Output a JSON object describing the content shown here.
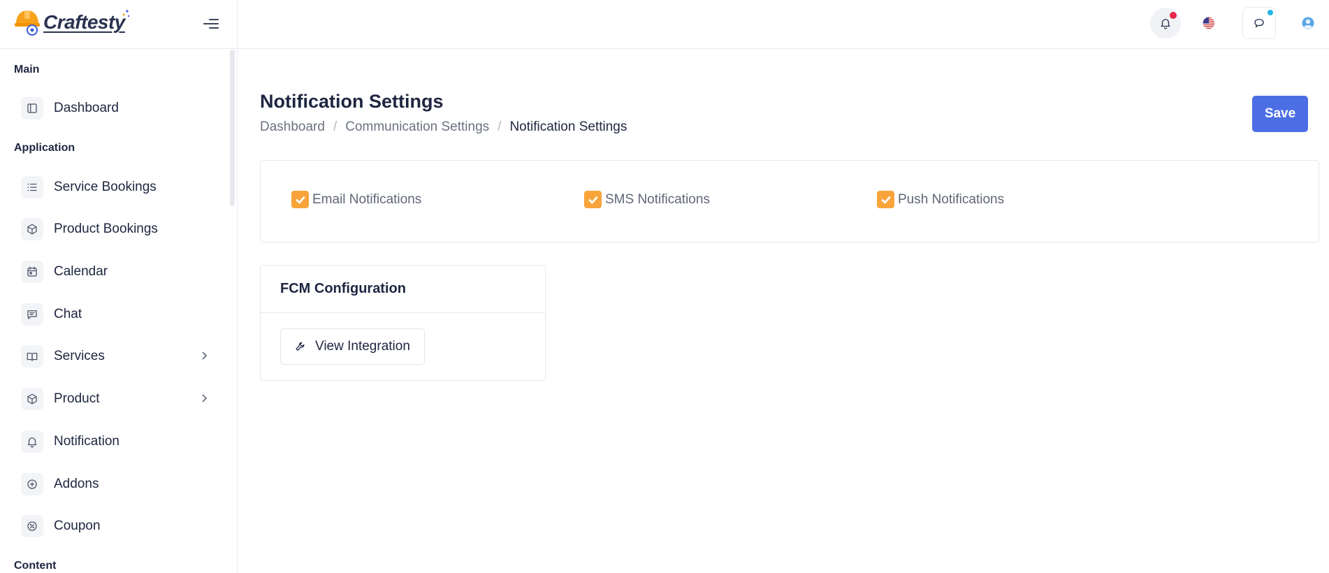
{
  "brand": {
    "name": "Craftesty"
  },
  "sidebar": {
    "sections": {
      "main": "Main",
      "application": "Application",
      "content": "Content"
    },
    "items": [
      {
        "label": "Dashboard",
        "icon": "layout-icon"
      },
      {
        "label": "Service Bookings",
        "icon": "list-icon"
      },
      {
        "label": "Product Bookings",
        "icon": "box-icon"
      },
      {
        "label": "Calendar",
        "icon": "calendar-icon"
      },
      {
        "label": "Chat",
        "icon": "message-icon"
      },
      {
        "label": "Services",
        "icon": "book-icon",
        "has_submenu": true
      },
      {
        "label": "Product",
        "icon": "box-icon",
        "has_submenu": true
      },
      {
        "label": "Notification",
        "icon": "bell-icon"
      },
      {
        "label": "Addons",
        "icon": "plus-circle-icon"
      },
      {
        "label": "Coupon",
        "icon": "discount-icon"
      }
    ]
  },
  "topbar": {
    "icons": [
      "bell-icon",
      "us-flag-icon",
      "chat-icon",
      "avatar"
    ],
    "notification_dot_color": "#e8274b",
    "chat_dot_color": "#1fb6e6"
  },
  "page": {
    "title": "Notification Settings",
    "breadcrumb": [
      "Dashboard",
      "Communication Settings",
      "Notification Settings"
    ],
    "save_label": "Save"
  },
  "notifications": {
    "email": {
      "label": "Email Notifications",
      "checked": true
    },
    "sms": {
      "label": "SMS Notifications",
      "checked": true
    },
    "push": {
      "label": "Push Notifications",
      "checked": true
    }
  },
  "fcm": {
    "title": "FCM Configuration",
    "button_label": "View Integration"
  },
  "colors": {
    "accent": "#4c6ee5",
    "checkbox": "#f8a43a",
    "text": "#1e2640"
  }
}
